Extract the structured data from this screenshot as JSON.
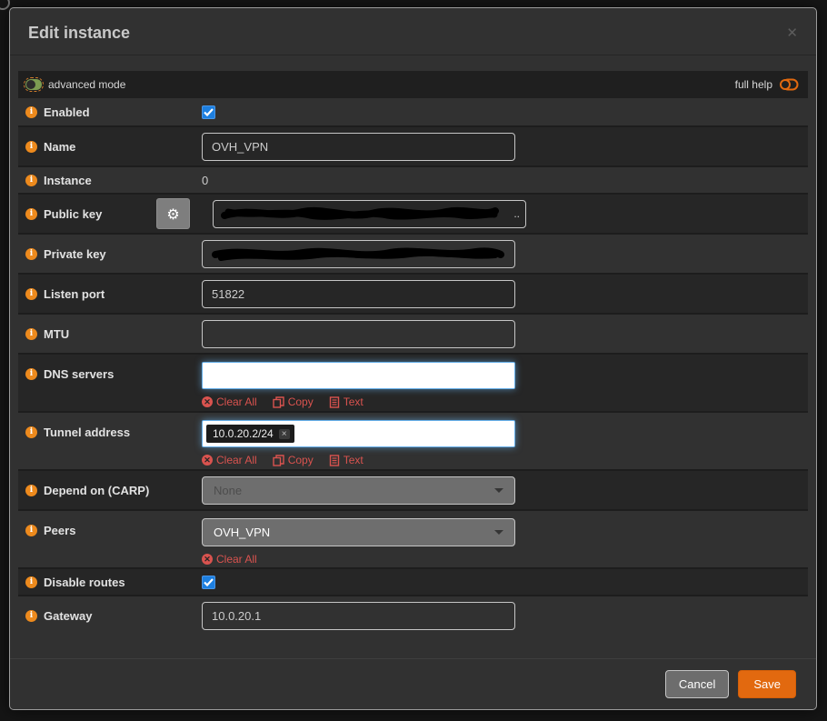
{
  "modal": {
    "title": "Edit instance",
    "close_glyph": "✕"
  },
  "toolbar": {
    "advanced_mode_label": "advanced mode",
    "full_help_label": "full help"
  },
  "fields": [
    {
      "label": "Enabled",
      "type": "checkbox",
      "checked": true
    },
    {
      "label": "Name",
      "type": "text",
      "value": "OVH_VPN"
    },
    {
      "label": "Instance",
      "type": "static",
      "value": "0"
    },
    {
      "label": "Public key",
      "type": "redacted",
      "suffix": "..",
      "gear_icon": "gear-icon",
      "gear_glyph": "⚙"
    },
    {
      "label": "Private key",
      "type": "redacted"
    },
    {
      "label": "Listen port",
      "type": "text",
      "value": "51822"
    },
    {
      "label": "MTU",
      "type": "text",
      "value": ""
    },
    {
      "label": "DNS servers",
      "type": "tokenfield",
      "tokens": [],
      "actions": [
        "Clear All",
        "Copy",
        "Text"
      ]
    },
    {
      "label": "Tunnel address",
      "type": "tokenfield",
      "tokens": [
        "10.0.20.2/24"
      ],
      "token_remove_glyph": "×",
      "actions": [
        "Clear All",
        "Copy",
        "Text"
      ]
    },
    {
      "label": "Depend on (CARP)",
      "type": "select",
      "value": "None",
      "disabled": true
    },
    {
      "label": "Peers",
      "type": "select",
      "value": "OVH_VPN",
      "actions": [
        "Clear All"
      ]
    },
    {
      "label": "Disable routes",
      "type": "checkbox",
      "checked": true
    },
    {
      "label": "Gateway",
      "type": "text",
      "value": "10.0.20.1"
    }
  ],
  "icons": {
    "label_icon": "info-circle-icon",
    "clear_glyph": "✕"
  },
  "footer": {
    "cancel_label": "Cancel",
    "save_label": "Save"
  },
  "colors": {
    "accent_orange": "#e2690f",
    "danger_red": "#d9534f",
    "checkbox_blue": "#1d7fe0",
    "token_focus_blue": "#66afe9",
    "toggle_green": "#7c9c52",
    "row_dark": "#262626",
    "row_light": "#313131",
    "modal_bg": "#313131"
  }
}
